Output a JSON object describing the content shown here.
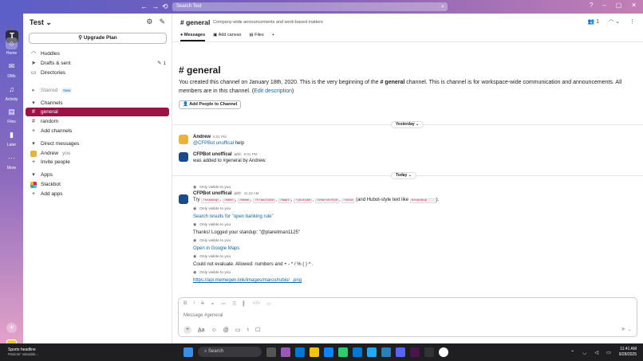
{
  "search": {
    "placeholder": "Search Test"
  },
  "rail": {
    "workspace_initial": "T",
    "items": [
      {
        "label": "Home"
      },
      {
        "label": "DMs"
      },
      {
        "label": "Activity"
      },
      {
        "label": "Files"
      },
      {
        "label": "Later"
      },
      {
        "label": "More"
      }
    ]
  },
  "sidebar": {
    "workspace_name": "Test",
    "upgrade": "Upgrade Plan",
    "huddles": "Huddles",
    "drafts": "Drafts & sent",
    "drafts_count": "1",
    "directories": "Directories",
    "starred": "Starred",
    "new_badge": "New",
    "channels_header": "Channels",
    "channels": [
      {
        "label": "general"
      },
      {
        "label": "random"
      }
    ],
    "add_channels": "Add channels",
    "dm_header": "Direct messages",
    "dm_user": "Andrew",
    "dm_you": "you",
    "invite": "Invite people",
    "apps_header": "Apps",
    "app": "Slackbot",
    "add_apps": "Add apps"
  },
  "channel": {
    "name": "# general",
    "description": "Company-wide announcements and work-based matters",
    "member_count": "1",
    "tabs": [
      {
        "label": "Messages"
      },
      {
        "label": "Add canvas"
      },
      {
        "label": "Files"
      }
    ],
    "intro_title": "# general",
    "intro_1": "You created this channel on January 18th, 2020. This is the very beginning of the",
    "intro_chan": "# general",
    "intro_2": "channel. This is channel is for workspace-wide communication and announcements. All members are in this channel. (",
    "intro_link": "Edit description",
    "intro_3": ")",
    "add_people": "Add People to Channel"
  },
  "dates": {
    "yesterday": "Yesterday",
    "today": "Today"
  },
  "messages": {
    "andrew": {
      "name": "Andrew",
      "time": "5:01 PM",
      "mention": "@CFPBot unoffical",
      "text": "help"
    },
    "bot1": {
      "name": "CFPBot unoffical",
      "app": "APP",
      "time": "5:01 PM",
      "text": "was added to #general by Andrew."
    },
    "bot2": {
      "name": "CFPBot unoffical",
      "app": "APP",
      "time": "11:23 AM",
      "visible": "Only visible to you",
      "try": "Try",
      "cmds": [
        "/standup",
        "/math",
        "/meme",
        "/translate",
        "/maps",
        "/youtube",
        "/searchcfpb",
        "/xkcd"
      ],
      "and_hubot": "(and Hubot-style text like",
      "standup_ex": "#standup ...",
      "close": ").",
      "r1": "Search results for \"open banking rule\"",
      "r2": "Thanks! Logged your standup: \"@planetman1125\"",
      "r3": "Open in Google Maps",
      "r4": "Could not evaluate. Allowed: numbers and + - * / % ( ) ^ .",
      "r5": "https://api.memegen.link/images/marco/rubio/_.png"
    }
  },
  "composer": {
    "placeholder": "Message #general"
  },
  "taskbar": {
    "news_title": "Sports headline",
    "news_sub": "Patriots' Valuable...",
    "search": "Search",
    "time": "11:41 AM",
    "date": "9/28/2025"
  }
}
